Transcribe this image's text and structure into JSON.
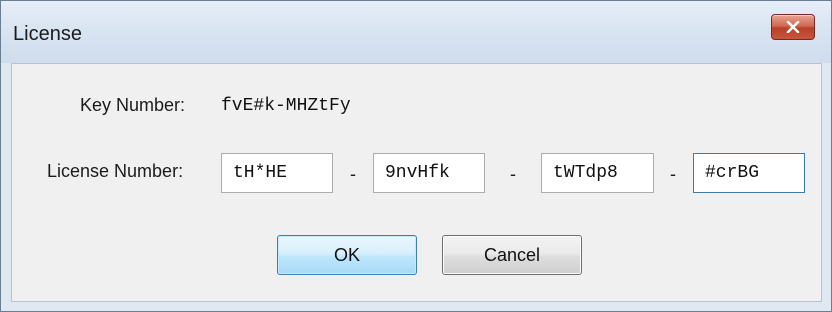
{
  "window": {
    "title": "License",
    "close_icon": "close-icon"
  },
  "key": {
    "label": "Key Number:",
    "value": "fvE#k-MHZtFy"
  },
  "license": {
    "label": "License Number:",
    "separator": "-",
    "segments": [
      "tH*HE",
      "9nvHfk",
      "tWTdp8",
      "#crBG"
    ]
  },
  "buttons": {
    "ok_label": "OK",
    "cancel_label": "Cancel"
  },
  "colors": {
    "close_button": "#c9563c",
    "ok_border": "#3c7fb1",
    "focused_field_border": "#3d7bad"
  }
}
